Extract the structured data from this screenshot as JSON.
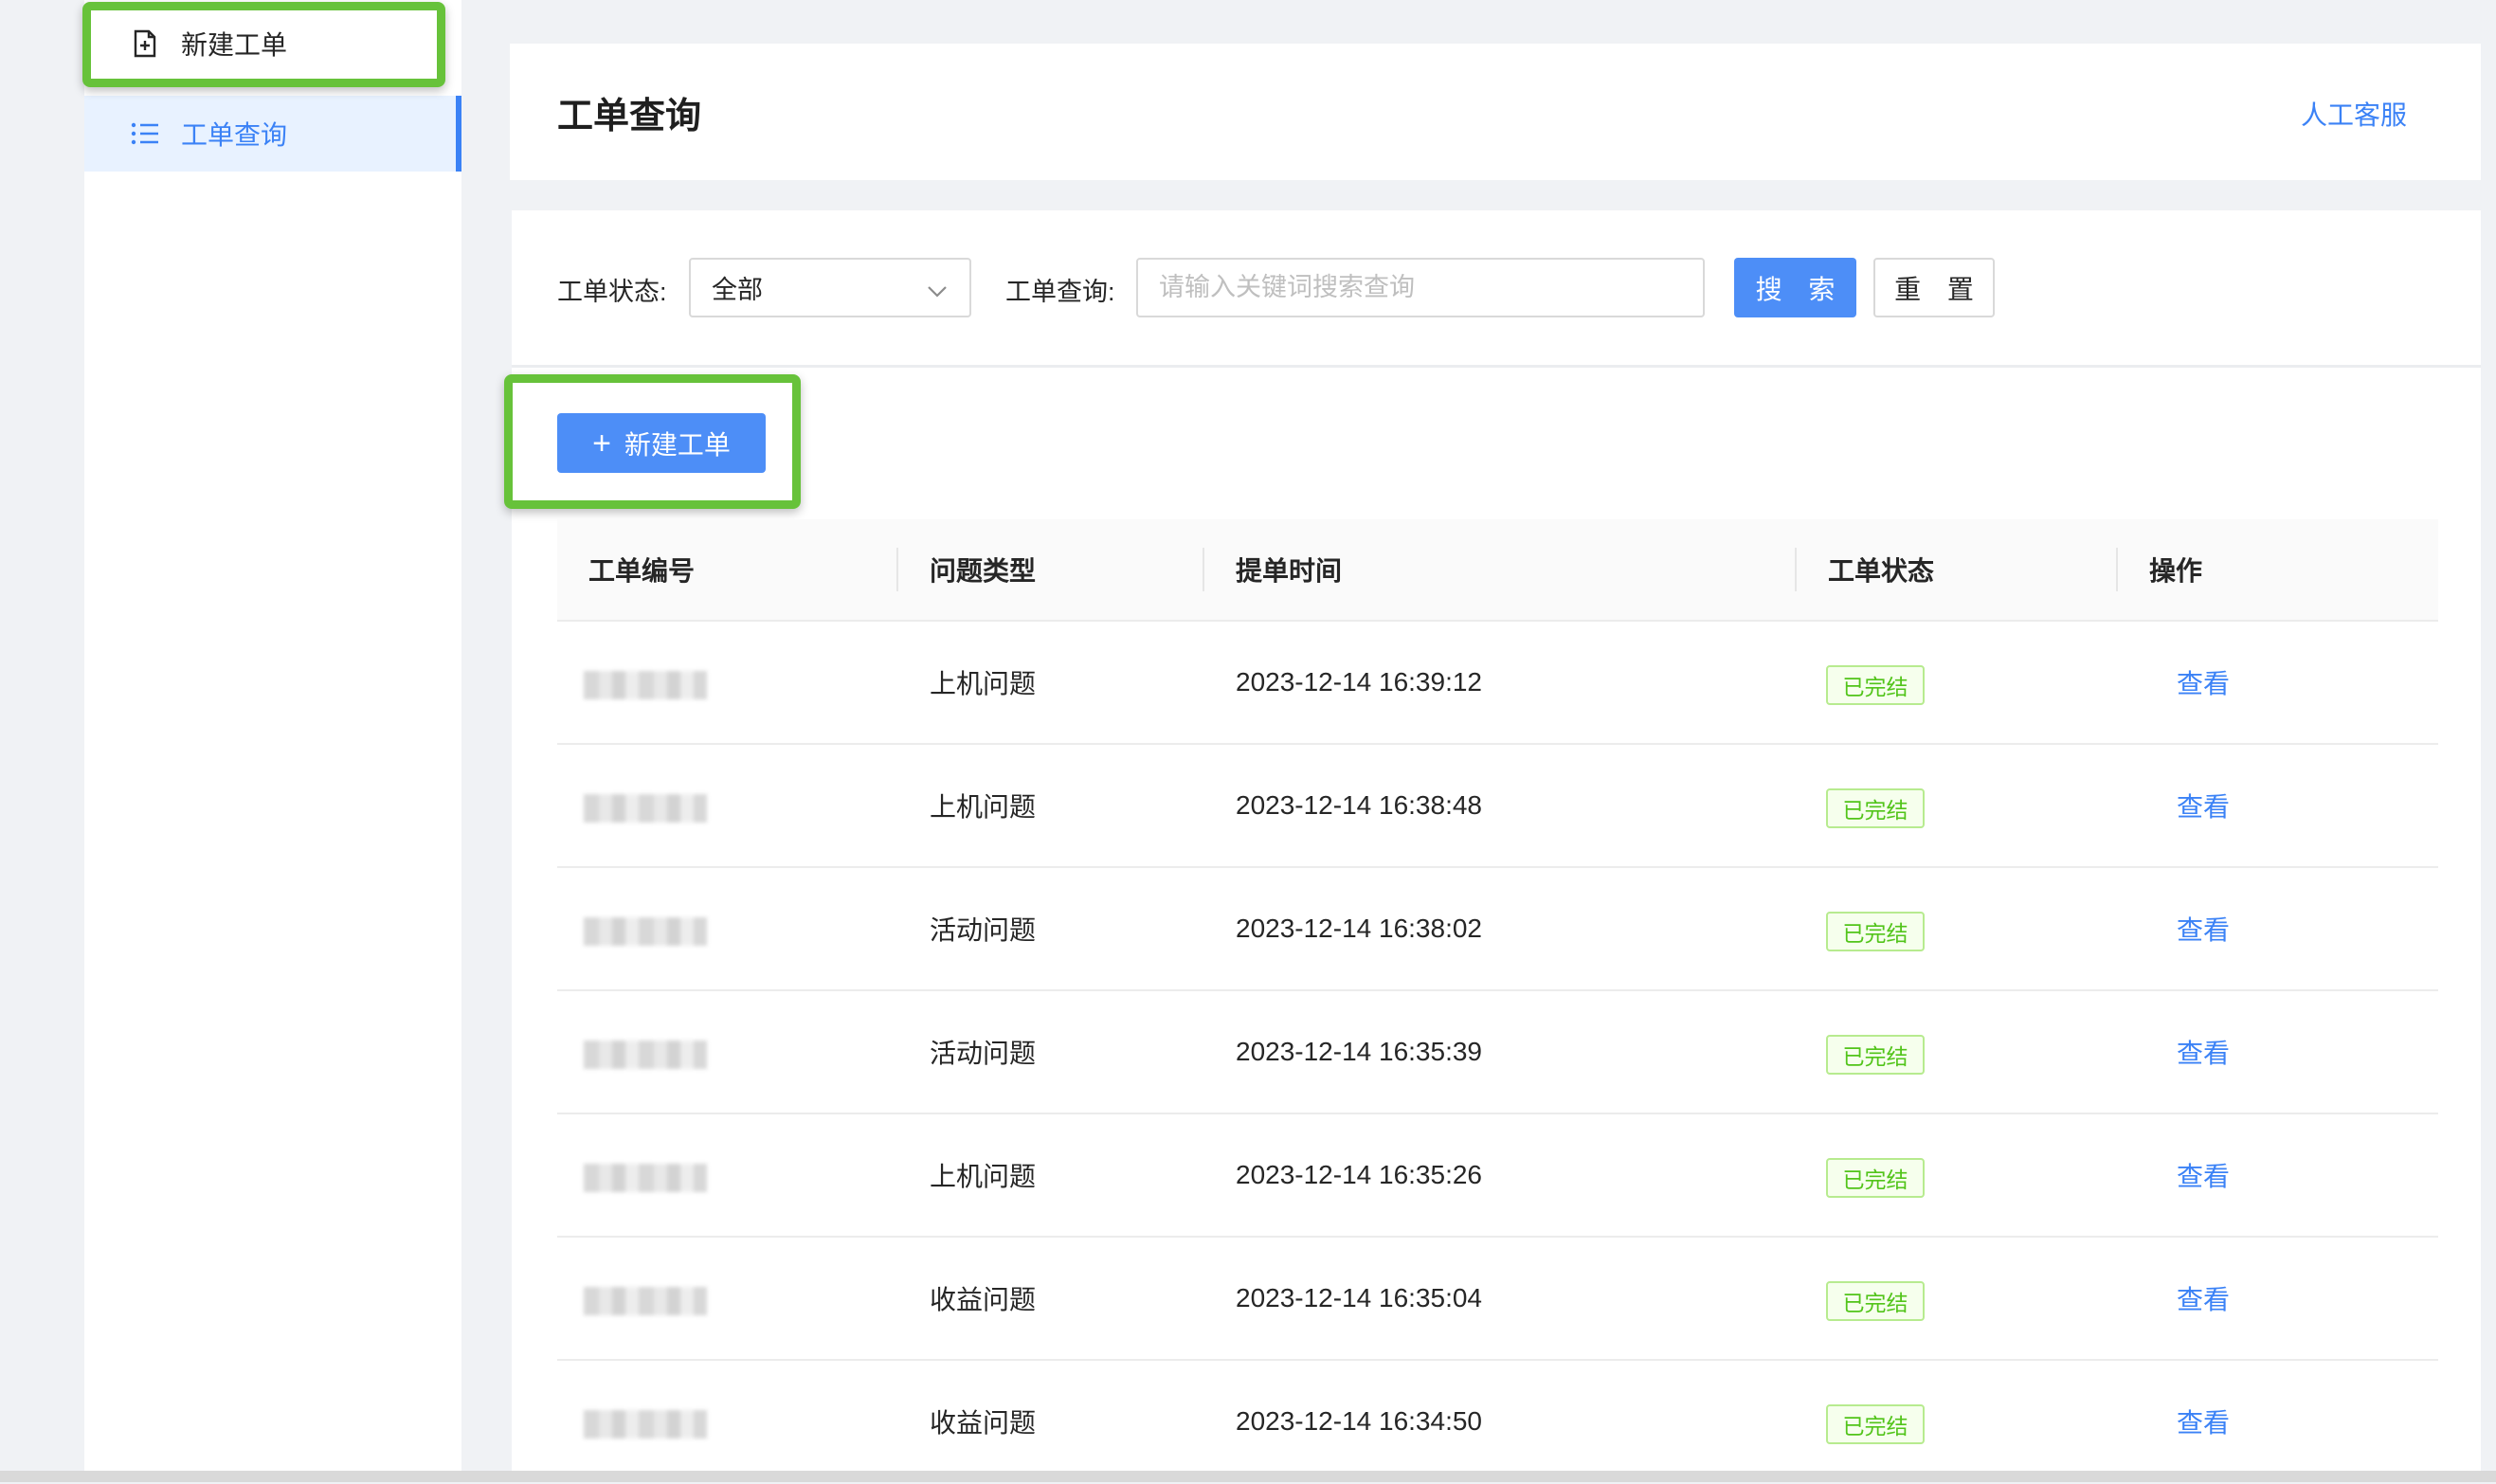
{
  "sidebar": {
    "new_ticket_label": "新建工单",
    "ticket_query_label": "工单查询"
  },
  "header": {
    "title": "工单查询",
    "service_link": "人工客服"
  },
  "filter": {
    "status_label": "工单状态:",
    "status_value": "全部",
    "query_label": "工单查询:",
    "query_placeholder": "请输入关键词搜索查询",
    "search_button": "搜 索",
    "reset_button": "重 置"
  },
  "toolbar": {
    "new_ticket_button": "新建工单"
  },
  "table": {
    "columns": [
      "工单编号",
      "问题类型",
      "提单时间",
      "工单状态",
      "操作"
    ],
    "rows": [
      {
        "type": "上机问题",
        "time": "2023-12-14 16:39:12",
        "status": "已完结",
        "action": "查看"
      },
      {
        "type": "上机问题",
        "time": "2023-12-14 16:38:48",
        "status": "已完结",
        "action": "查看"
      },
      {
        "type": "活动问题",
        "time": "2023-12-14 16:38:02",
        "status": "已完结",
        "action": "查看"
      },
      {
        "type": "活动问题",
        "time": "2023-12-14 16:35:39",
        "status": "已完结",
        "action": "查看"
      },
      {
        "type": "上机问题",
        "time": "2023-12-14 16:35:26",
        "status": "已完结",
        "action": "查看"
      },
      {
        "type": "收益问题",
        "time": "2023-12-14 16:35:04",
        "status": "已完结",
        "action": "查看"
      },
      {
        "type": "收益问题",
        "time": "2023-12-14 16:34:50",
        "status": "已完结",
        "action": "查看"
      }
    ]
  },
  "colors": {
    "primary": "#3b82f6",
    "button_primary": "#4d8ef7",
    "highlight_green": "#67c23a",
    "tag_green": "#52c41a"
  }
}
